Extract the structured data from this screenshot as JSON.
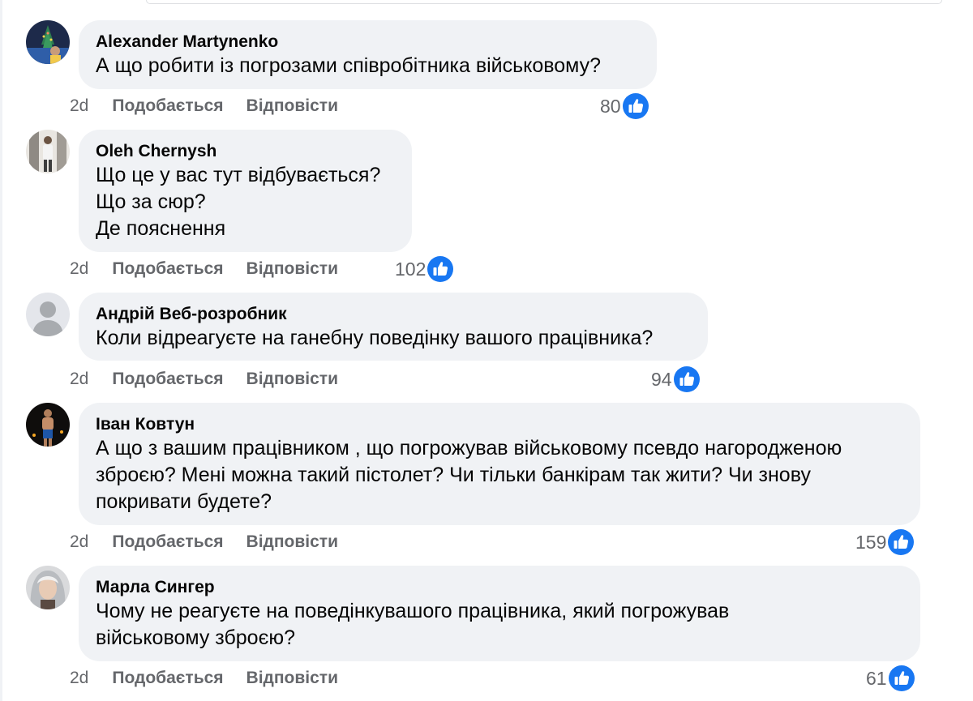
{
  "colors": {
    "bubble": "#f0f2f5",
    "secondary_text": "#65676b",
    "like_blue": "#1877f2"
  },
  "icons": {
    "reaction": "like-thumbs-up-icon"
  },
  "comments": [
    {
      "author": "Alexander Martynenko",
      "text": "А що робити із погрозами співробітника військовому?",
      "time": "2d",
      "like_label": "Подобається",
      "reply_label": "Відповісти",
      "reactions": "80"
    },
    {
      "author": "Oleh Chernysh",
      "text": "Що це у вас тут відбувається?\nЩо за сюр?\nДе пояснення",
      "time": "2d",
      "like_label": "Подобається",
      "reply_label": "Відповісти",
      "reactions": "102"
    },
    {
      "author": "Андрій Веб-розробник",
      "text": "Коли відреагуєте на ганебну поведінку вашого працівника?",
      "time": "2d",
      "like_label": "Подобається",
      "reply_label": "Відповісти",
      "reactions": "94"
    },
    {
      "author": "Іван Ковтун",
      "text": "А що з вашим працівником , що погрожував військовому псевдо нагородженою\nзброєю? Мені можна такий пістолет? Чи тільки банкірам так жити? Чи знову\nпокривати будете?",
      "time": "2d",
      "like_label": "Подобається",
      "reply_label": "Відповісти",
      "reactions": "159"
    },
    {
      "author": "Марла Сингер",
      "text": "Чому не реагуєте на поведінкувашого працівника, який погрожував\nвійськовому зброєю?",
      "time": "2d",
      "like_label": "Подобається",
      "reply_label": "Відповісти",
      "reactions": "61"
    }
  ]
}
